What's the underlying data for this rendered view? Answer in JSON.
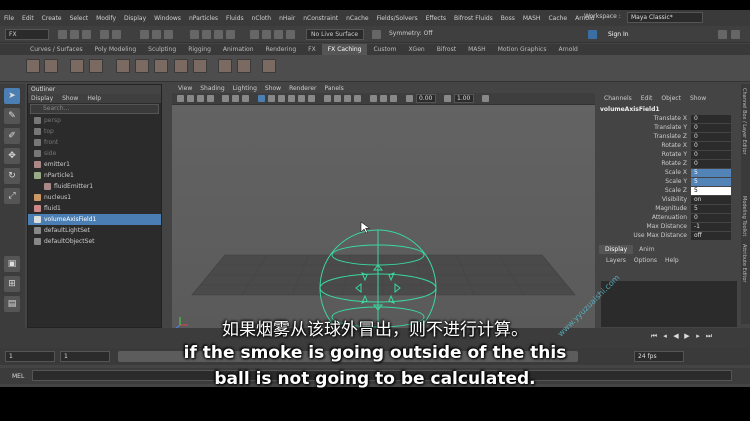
{
  "menubar": {
    "items": [
      "File",
      "Edit",
      "Create",
      "Select",
      "Modify",
      "Display",
      "Windows",
      "nParticles",
      "Fluids",
      "nCloth",
      "nHair",
      "nConstraint",
      "nCache",
      "Fields/Solvers",
      "Effects",
      "Bifrost Fluids",
      "Boss",
      "MASH",
      "Cache",
      "Arnold"
    ],
    "workspace_label": "Workspace :",
    "workspace_value": "Maya Classic*"
  },
  "statusline": {
    "mode": "FX",
    "live_surface": "No Live Surface",
    "symmetry": "Symmetry: Off",
    "sign_in": "Sign In"
  },
  "shelf": {
    "tabs": [
      "Curves / Surfaces",
      "Poly Modeling",
      "Sculpting",
      "Rigging",
      "Animation",
      "Rendering",
      "FX",
      "FX Caching",
      "Custom",
      "XGen",
      "Bifrost",
      "MASH",
      "Motion Graphics",
      "Arnold"
    ],
    "active_tab": "FX Caching"
  },
  "outliner": {
    "title": "Outliner",
    "menu": [
      "Display",
      "Show",
      "Help"
    ],
    "search_placeholder": "Search...",
    "items": [
      {
        "label": "persp",
        "state": "dim"
      },
      {
        "label": "top",
        "state": "dim"
      },
      {
        "label": "front",
        "state": "dim"
      },
      {
        "label": "side",
        "state": "dim"
      },
      {
        "label": "emitter1",
        "state": "normal"
      },
      {
        "label": "nParticle1",
        "state": "normal"
      },
      {
        "label": "fluidEmitter1",
        "state": "normal"
      },
      {
        "label": "nucleus1",
        "state": "normal"
      },
      {
        "label": "fluid1",
        "state": "normal"
      },
      {
        "label": "volumeAxisField1",
        "state": "selected"
      },
      {
        "label": "defaultLightSet",
        "state": "normal"
      },
      {
        "label": "defaultObjectSet",
        "state": "normal"
      }
    ]
  },
  "viewport": {
    "menu": [
      "View",
      "Shading",
      "Lighting",
      "Show",
      "Renderer",
      "Panels"
    ],
    "num1": "0.00",
    "num2": "1.00"
  },
  "channelbox": {
    "menu": [
      "Channels",
      "Edit",
      "Object",
      "Show"
    ],
    "object": "volumeAxisField1",
    "attributes": [
      {
        "label": "Translate X",
        "value": "0",
        "state": "normal"
      },
      {
        "label": "Translate Y",
        "value": "0",
        "state": "normal"
      },
      {
        "label": "Translate Z",
        "value": "0",
        "state": "normal"
      },
      {
        "label": "Rotate X",
        "value": "0",
        "state": "normal"
      },
      {
        "label": "Rotate Y",
        "value": "0",
        "state": "normal"
      },
      {
        "label": "Rotate Z",
        "value": "0",
        "state": "normal"
      },
      {
        "label": "Scale X",
        "value": "5",
        "state": "hi"
      },
      {
        "label": "Scale Y",
        "value": "5",
        "state": "hi"
      },
      {
        "label": "Scale Z",
        "value": "5",
        "state": "edit"
      },
      {
        "label": "Visibility",
        "value": "on",
        "state": "normal"
      },
      {
        "label": "Magnitude",
        "value": "5",
        "state": "normal"
      },
      {
        "label": "Attenuation",
        "value": "0",
        "state": "normal"
      },
      {
        "label": "Max Distance",
        "value": "-1",
        "state": "normal"
      },
      {
        "label": "Use Max Distance",
        "value": "off",
        "state": "normal"
      }
    ],
    "side_tabs": [
      "Channel Box / Layer Editor",
      "Modeling Toolkit",
      "Attribute Editor"
    ]
  },
  "layers": {
    "tabs": [
      "Display",
      "Anim"
    ],
    "menu": [
      "Layers",
      "Options",
      "Help"
    ]
  },
  "timeline": {
    "start": "1",
    "current": "1",
    "fps": "24 fps"
  },
  "mel": {
    "label": "MEL"
  },
  "subtitles": {
    "chinese": "如果烟雾从该球外冒出，则不进行计算。",
    "english_line1": "if the smoke is going outside of the this",
    "english_line2": "ball is not going to be calculated."
  },
  "watermark": "www.yyuzuaishi.com",
  "colors": {
    "accent": "#4b7fb3",
    "field_wire": "#3ad9a0",
    "viewport_bg": "#5e5e5e"
  }
}
